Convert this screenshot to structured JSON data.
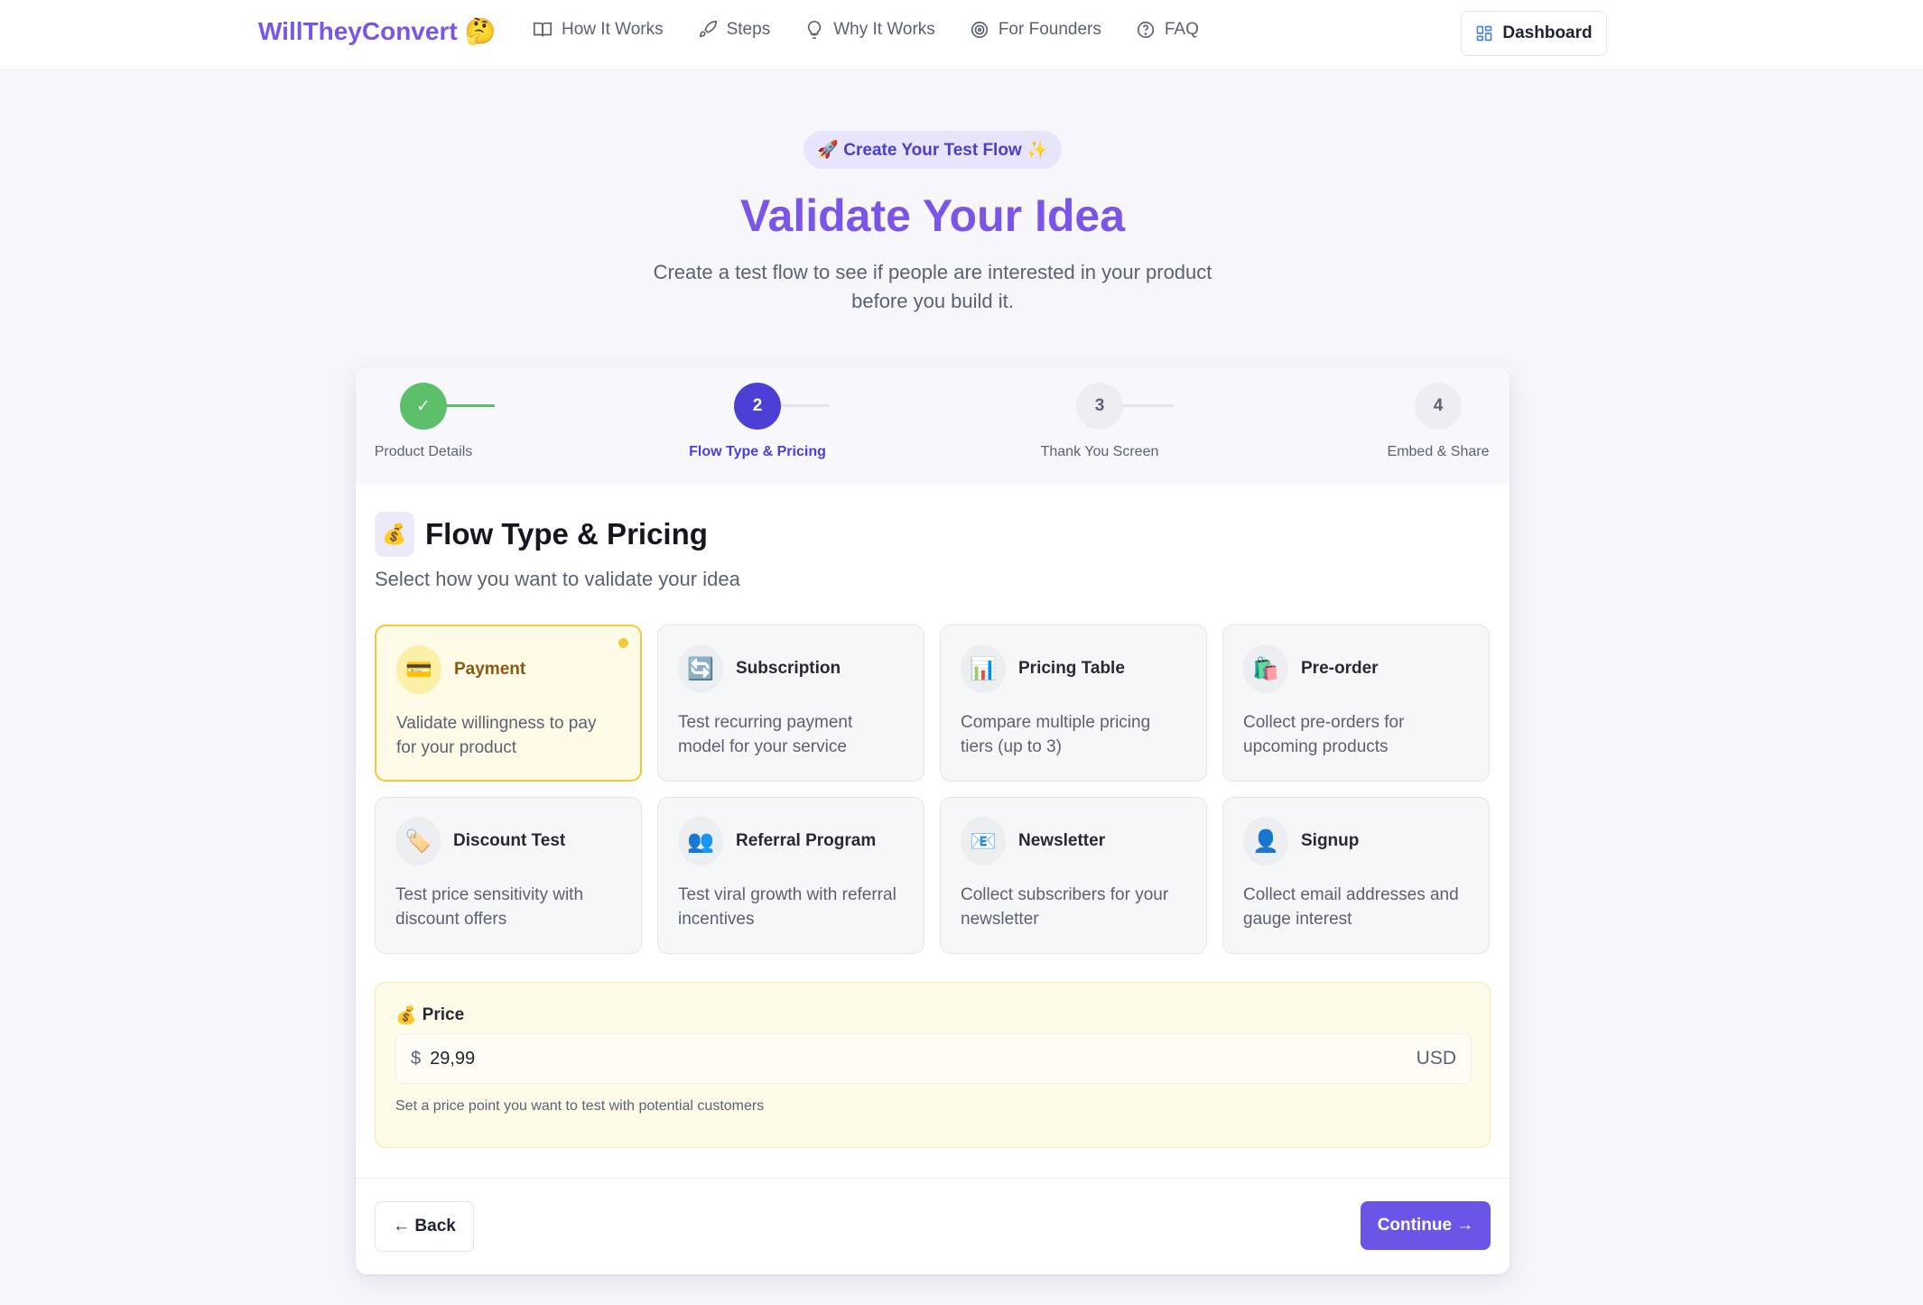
{
  "nav": {
    "brand": "WillTheyConvert",
    "brand_emoji": "🤔",
    "links": [
      {
        "label": "How It Works",
        "icon": "book-icon"
      },
      {
        "label": "Steps",
        "icon": "rocket-icon"
      },
      {
        "label": "Why It Works",
        "icon": "lightbulb-icon"
      },
      {
        "label": "For Founders",
        "icon": "target-icon"
      },
      {
        "label": "FAQ",
        "icon": "help-circle-icon"
      }
    ],
    "dashboard_label": "Dashboard"
  },
  "hero": {
    "pill": "🚀 Create Your Test Flow ✨",
    "title": "Validate Your Idea",
    "subtitle": "Create a test flow to see if people are interested in your product before you build it."
  },
  "steps": [
    {
      "number": "✓",
      "label": "Product Details",
      "state": "done"
    },
    {
      "number": "2",
      "label": "Flow Type & Pricing",
      "state": "active"
    },
    {
      "number": "3",
      "label": "Thank You Screen",
      "state": "pending"
    },
    {
      "number": "4",
      "label": "Embed & Share",
      "state": "pending"
    }
  ],
  "section": {
    "icon": "💰",
    "title": "Flow Type & Pricing",
    "subtitle": "Select how you want to validate your idea"
  },
  "options": [
    {
      "icon": "💳",
      "name": "Payment",
      "desc": "Validate willingness to pay for your product",
      "selected": true
    },
    {
      "icon": "🔄",
      "name": "Subscription",
      "desc": "Test recurring payment model for your service",
      "selected": false
    },
    {
      "icon": "📊",
      "name": "Pricing Table",
      "desc": "Compare multiple pricing tiers (up to 3)",
      "selected": false
    },
    {
      "icon": "🛍️",
      "name": "Pre-order",
      "desc": "Collect pre-orders for upcoming products",
      "selected": false
    },
    {
      "icon": "🏷️",
      "name": "Discount Test",
      "desc": "Test price sensitivity with discount offers",
      "selected": false
    },
    {
      "icon": "👥",
      "name": "Referral Program",
      "desc": "Test viral growth with referral incentives",
      "selected": false
    },
    {
      "icon": "📧",
      "name": "Newsletter",
      "desc": "Collect subscribers for your newsletter",
      "selected": false
    },
    {
      "icon": "👤",
      "name": "Signup",
      "desc": "Collect email addresses and gauge interest",
      "selected": false
    }
  ],
  "price": {
    "icon": "💰",
    "label": "Price",
    "currency_symbol": "$",
    "value": "29,99",
    "unit": "USD",
    "hint": "Set a price point you want to test with potential customers"
  },
  "footer": {
    "back_label": "← Back",
    "continue_label": "Continue →"
  },
  "colors": {
    "brand": "#7a55e8",
    "accent": "#6b55e6",
    "step_done": "#5cc06b",
    "step_active": "#4b3fd6",
    "selected_border": "#f0c93c"
  }
}
